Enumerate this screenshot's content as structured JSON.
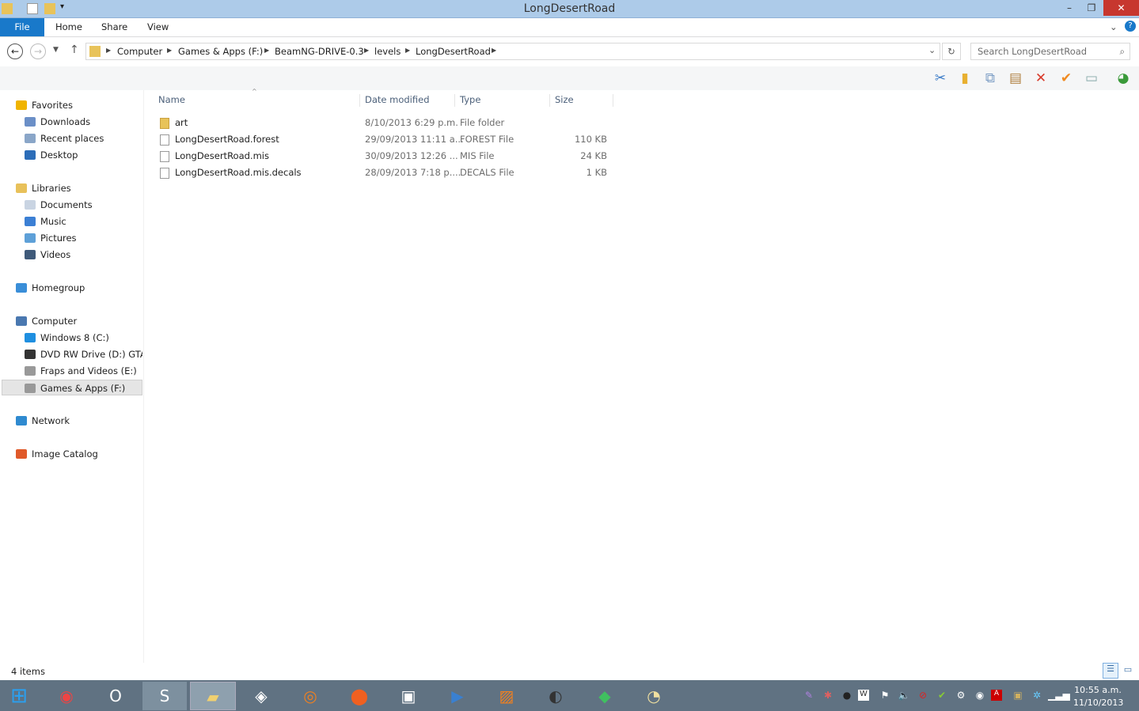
{
  "window": {
    "title": "LongDesertRoad"
  },
  "ribbon": {
    "tabs": [
      "File",
      "Home",
      "Share",
      "View"
    ]
  },
  "address": {
    "crumbs": [
      "Computer",
      "Games & Apps (F:)",
      "BeamNG-DRIVE-0.3",
      "levels",
      "LongDesertRoad"
    ],
    "search_placeholder": "Search LongDesertRoad"
  },
  "nav": {
    "items": [
      {
        "label": "Favorites",
        "color": "#f0b400",
        "indent": 0
      },
      {
        "label": "Downloads",
        "color": "#6b8fc7",
        "indent": 1
      },
      {
        "label": "Recent places",
        "color": "#8aa6c8",
        "indent": 1
      },
      {
        "label": "Desktop",
        "color": "#2c6db8",
        "indent": 1
      },
      {
        "label": "Libraries",
        "color": "#e8c15a",
        "indent": 0
      },
      {
        "label": "Documents",
        "color": "#c9d4e2",
        "indent": 1
      },
      {
        "label": "Music",
        "color": "#3b7fd4",
        "indent": 1
      },
      {
        "label": "Pictures",
        "color": "#5ea0d8",
        "indent": 1
      },
      {
        "label": "Videos",
        "color": "#3f5a7a",
        "indent": 1
      },
      {
        "label": "Homegroup",
        "color": "#3a8ed8",
        "indent": 0
      },
      {
        "label": "Computer",
        "color": "#4a78b0",
        "indent": 0
      },
      {
        "label": "Windows 8 (C:)",
        "color": "#1f8fe0",
        "indent": 1
      },
      {
        "label": "DVD RW Drive (D:) GTA I",
        "color": "#333",
        "indent": 1
      },
      {
        "label": "Fraps and Videos (E:)",
        "color": "#999",
        "indent": 1
      },
      {
        "label": "Games & Apps (F:)",
        "color": "#999",
        "indent": 1,
        "selected": true
      },
      {
        "label": "Network",
        "color": "#2f8ad0",
        "indent": 0
      },
      {
        "label": "Image Catalog",
        "color": "#e05a2a",
        "indent": 0
      }
    ]
  },
  "columns": [
    "Name",
    "Date modified",
    "Type",
    "Size"
  ],
  "files": [
    {
      "name": "art",
      "date": "8/10/2013 6:29 p.m.",
      "type": "File folder",
      "size": "",
      "folder": true
    },
    {
      "name": "LongDesertRoad.forest",
      "date": "29/09/2013 11:11 a...",
      "type": "FOREST File",
      "size": "110 KB"
    },
    {
      "name": "LongDesertRoad.mis",
      "date": "30/09/2013 12:26 ...",
      "type": "MIS File",
      "size": "24 KB"
    },
    {
      "name": "LongDesertRoad.mis.decals",
      "date": "28/09/2013 7:18 p....",
      "type": "DECALS File",
      "size": "1 KB"
    }
  ],
  "status": {
    "count": "4 items"
  },
  "clock": {
    "time": "10:55 a.m.",
    "date": "11/10/2013"
  }
}
